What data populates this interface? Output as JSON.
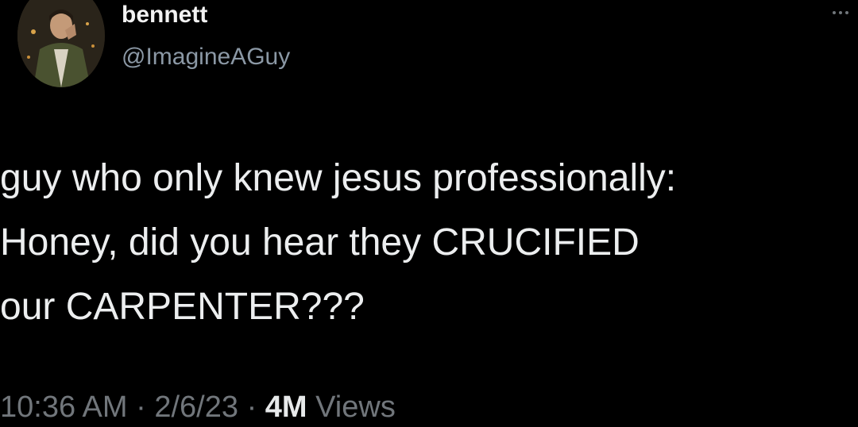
{
  "author": {
    "display_name": "bennett",
    "handle": "@ImagineAGuy",
    "avatar_icon": "profile-photo"
  },
  "more_icon": "more-options-icon",
  "tweet": {
    "lines": [
      "guy who only knew jesus professionally:",
      "Honey, did you hear they CRUCIFIED",
      "our CARPENTER???"
    ]
  },
  "meta": {
    "time": "10:36 AM",
    "separator": "·",
    "date": "2/6/23",
    "views_count": "4M",
    "views_label": "Views"
  },
  "colors": {
    "background": "#000000",
    "text": "#e7e9ea",
    "secondary": "#71767b"
  }
}
